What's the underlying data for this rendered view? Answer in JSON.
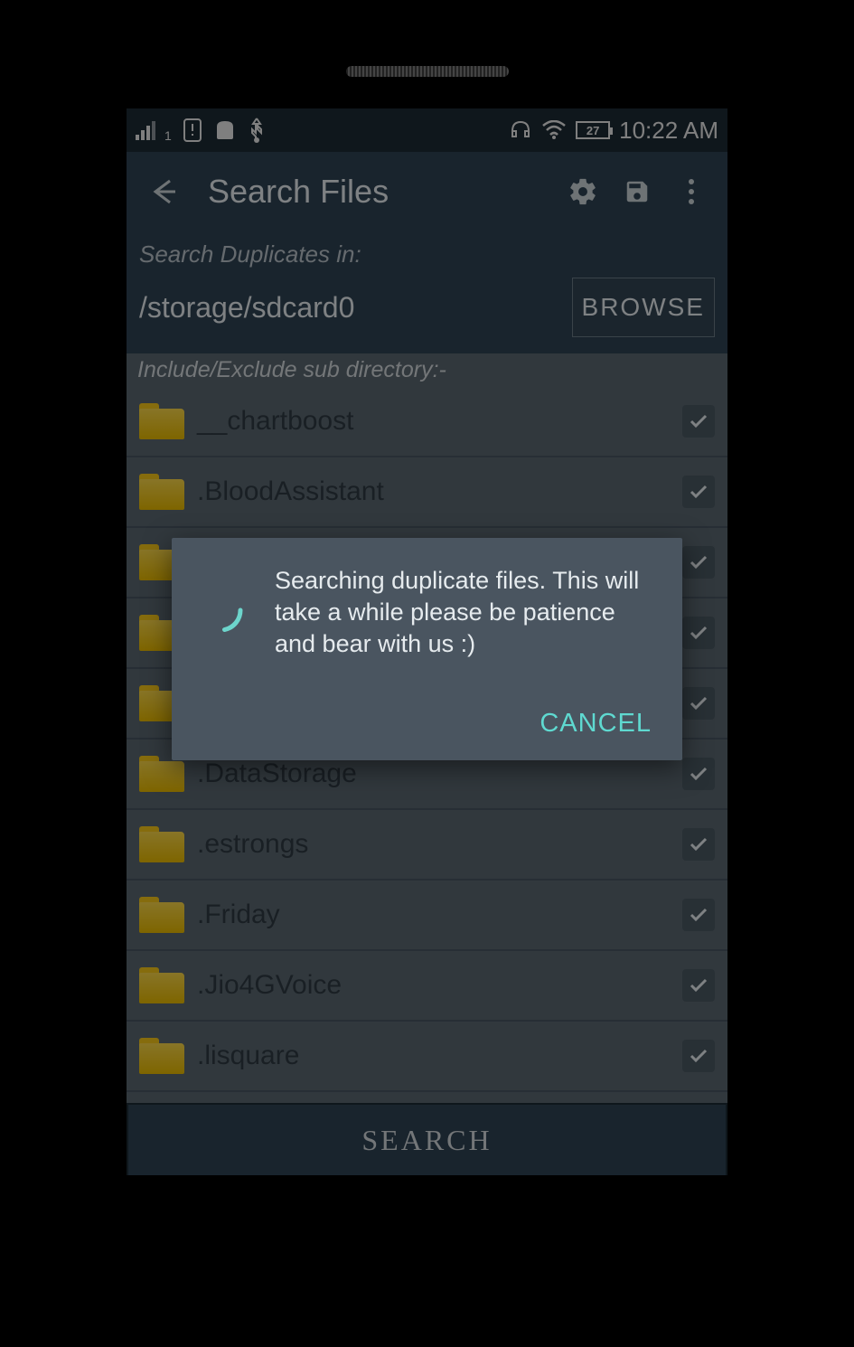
{
  "status_bar": {
    "time": "10:22 AM",
    "battery_level": "27"
  },
  "toolbar": {
    "title": "Search Files"
  },
  "search": {
    "label": "Search Duplicates in:",
    "path": "/storage/sdcard0",
    "browse_label": "BROWSE",
    "subdir_label": "Include/Exclude sub directory:-"
  },
  "folders": [
    {
      "name": "__chartboost",
      "checked": true
    },
    {
      "name": ".BloodAssistant",
      "checked": true
    },
    {
      "name": "",
      "checked": true
    },
    {
      "name": "",
      "checked": true
    },
    {
      "name": "",
      "checked": true
    },
    {
      "name": ".DataStorage",
      "checked": true
    },
    {
      "name": ".estrongs",
      "checked": true
    },
    {
      "name": ".Friday",
      "checked": true
    },
    {
      "name": ".Jio4GVoice",
      "checked": true
    },
    {
      "name": ".lisquare",
      "checked": true
    }
  ],
  "search_button": "SEARCH",
  "dialog": {
    "message": "Searching duplicate files. This will take a while please be patience and bear with us :)",
    "cancel_label": "CANCEL"
  }
}
